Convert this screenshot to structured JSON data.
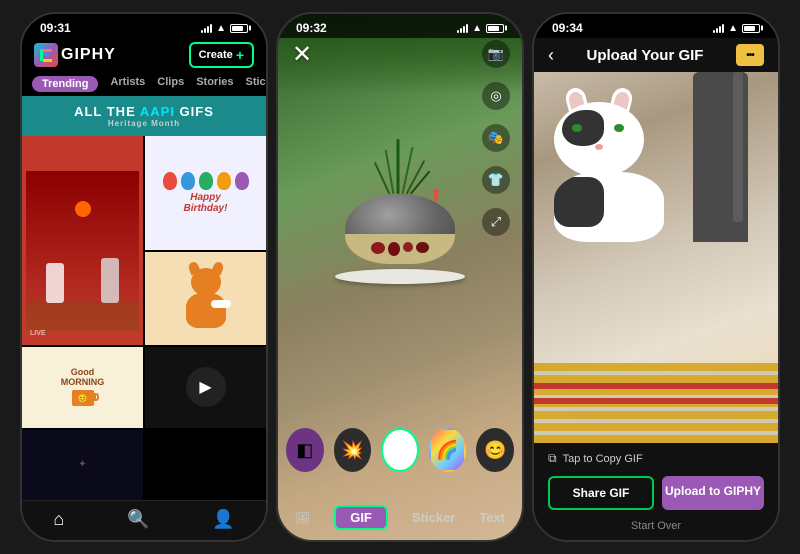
{
  "phones": [
    {
      "id": "phone1",
      "status_bar": {
        "time": "09:31",
        "signal": true,
        "wifi": true,
        "battery": true
      },
      "header": {
        "logo_text": "GIPHY",
        "create_label": "Create"
      },
      "nav_tabs": [
        {
          "label": "Trending",
          "active": true
        },
        {
          "label": "Artists",
          "active": false
        },
        {
          "label": "Clips",
          "active": false
        },
        {
          "label": "Stories",
          "active": false
        },
        {
          "label": "Sticker",
          "active": false
        }
      ],
      "banner": {
        "prefix": "ALL THE ",
        "highlight": "AAPI",
        "suffix": " GIFS",
        "sub": "Heritage Month"
      },
      "bottom_nav": [
        "home",
        "search",
        "profile"
      ]
    },
    {
      "id": "phone2",
      "status_bar": {
        "time": "09:32",
        "signal": true,
        "wifi": true,
        "battery": true
      },
      "camera": {
        "close": "×",
        "right_icons": [
          "camera-flip",
          "filter",
          "sticker-tool",
          "timer",
          "expand"
        ],
        "stickers": [
          "purple",
          "explosion",
          "white",
          "rainbow",
          "emoji"
        ],
        "tabs": [
          {
            "label": "GIF",
            "active": true,
            "icon": "image"
          },
          {
            "label": "Sticker",
            "active": false
          },
          {
            "label": "Text",
            "active": false
          }
        ]
      }
    },
    {
      "id": "phone3",
      "status_bar": {
        "time": "09:34",
        "signal": true,
        "wifi": true,
        "battery": true
      },
      "header": {
        "back_icon": "‹",
        "title": "Upload Your GIF",
        "more_icon": "•••"
      },
      "actions": {
        "tap_copy_label": "Tap to Copy GIF",
        "share_label": "Share GIF",
        "upload_label": "Upload to GIPHY",
        "start_over_label": "Start Over"
      }
    }
  ]
}
